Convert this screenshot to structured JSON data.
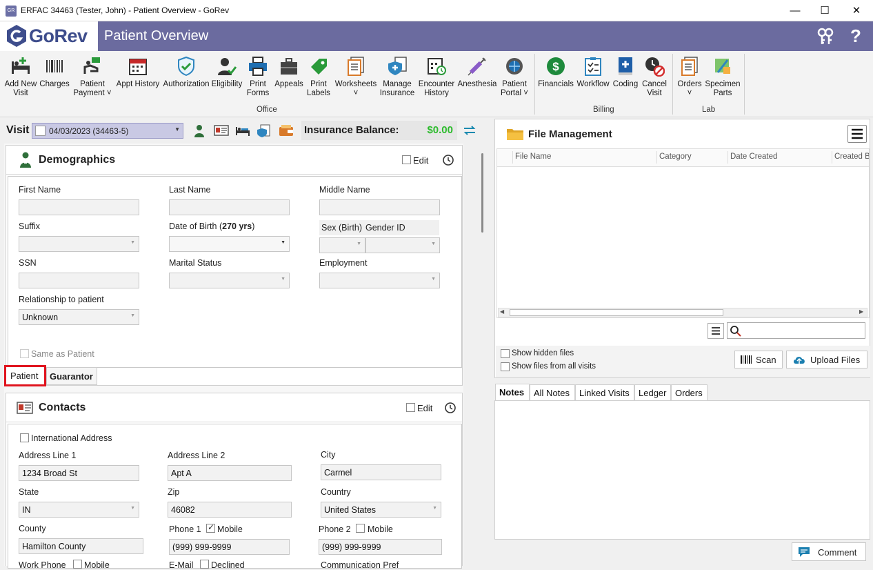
{
  "window": {
    "title": "ERFAC 34463 (Tester, John) - Patient Overview - GoRev",
    "app_icon_text": "GoRev"
  },
  "header": {
    "logo_text": "GoRev",
    "page_title": "Patient Overview"
  },
  "ribbon": {
    "office": [
      {
        "label": "Add New\nVisit",
        "icon": "bed-plus-icon"
      },
      {
        "label": "Charges",
        "icon": "barcode-icon"
      },
      {
        "label": "Patient\nPayment ˅",
        "icon": "hand-money-icon"
      },
      {
        "label": "Appt History",
        "icon": "calendar-icon"
      },
      {
        "label": "Authorization",
        "icon": "shield-check-icon"
      },
      {
        "label": "Eligibility",
        "icon": "person-check-icon"
      },
      {
        "label": "Print\nForms",
        "icon": "printer-icon"
      },
      {
        "label": "Appeals",
        "icon": "briefcase-icon"
      },
      {
        "label": "Print\nLabels",
        "icon": "tag-icon"
      },
      {
        "label": "Worksheets\n˅",
        "icon": "worksheets-icon"
      },
      {
        "label": "Manage\nInsurance",
        "icon": "insurance-icon"
      },
      {
        "label": "Encounter\nHistory",
        "icon": "encounter-history-icon"
      },
      {
        "label": "Anesthesia",
        "icon": "syringe-icon"
      },
      {
        "label": "Patient\nPortal ˅",
        "icon": "globe-gear-icon"
      }
    ],
    "billing": [
      {
        "label": "Financials",
        "icon": "dollar-icon"
      },
      {
        "label": "Workflow",
        "icon": "workflow-icon"
      },
      {
        "label": "Coding",
        "icon": "book-plus-icon"
      },
      {
        "label": "Cancel\nVisit",
        "icon": "cancel-clock-icon"
      }
    ],
    "lab": [
      {
        "label": "Orders\n˅",
        "icon": "orders-icon"
      },
      {
        "label": "Specimen\nParts",
        "icon": "specimen-icon"
      }
    ],
    "groups": {
      "office": "Office",
      "billing": "Billing",
      "lab": "Lab"
    }
  },
  "visitbar": {
    "label": "Visit",
    "selected": "04/03/2023 (34463-5)",
    "insurance_label": "Insurance Balance:",
    "insurance_value": "$0.00"
  },
  "demographics": {
    "title": "Demographics",
    "edit_label": "Edit",
    "first_name_label": "First Name",
    "last_name_label": "Last Name",
    "middle_name_label": "Middle Name",
    "suffix_label": "Suffix",
    "dob_label": "Date of Birth (",
    "dob_age": "270 yrs",
    "dob_close": ")",
    "sex_label": "Sex (Birth)",
    "gender_label": "Gender ID",
    "ssn_label": "SSN",
    "marital_label": "Marital Status",
    "employment_label": "Employment",
    "relationship_label": "Relationship to patient",
    "relationship_value": "Unknown",
    "same_as_patient": "Same as Patient",
    "tabs": [
      "Patient",
      "Guarantor"
    ]
  },
  "contacts": {
    "title": "Contacts",
    "edit_label": "Edit",
    "international": "International Address",
    "addr1_label": "Address Line 1",
    "addr1_value": "1234 Broad St",
    "addr2_label": "Address Line 2",
    "addr2_value": "Apt A",
    "city_label": "City",
    "city_value": "Carmel",
    "state_label": "State",
    "state_value": "IN",
    "zip_label": "Zip",
    "zip_value": "46082",
    "country_label": "Country",
    "country_value": "United States",
    "county_label": "County",
    "county_value": "Hamilton County",
    "phone1_label": "Phone 1",
    "phone1_mobile": "Mobile",
    "phone1_value": "(999) 999-9999",
    "phone2_label": "Phone 2",
    "phone2_mobile": "Mobile",
    "phone2_value": "(999) 999-9999",
    "workphone_label": "Work Phone",
    "workphone_mobile": "Mobile",
    "email_label": "E-Mail",
    "email_declined": "Declined",
    "comm_label": "Communication Pref"
  },
  "files": {
    "title": "File Management",
    "columns": [
      "File Name",
      "Category",
      "Date Created",
      "Created B"
    ],
    "show_hidden": "Show hidden files",
    "show_all_visits": "Show files from all visits",
    "scan_label": "Scan",
    "upload_label": "Upload Files",
    "search_placeholder": ""
  },
  "notes": {
    "tabs": [
      "Notes",
      "All Notes",
      "Linked Visits",
      "Ledger",
      "Orders"
    ],
    "comment_label": "Comment"
  }
}
